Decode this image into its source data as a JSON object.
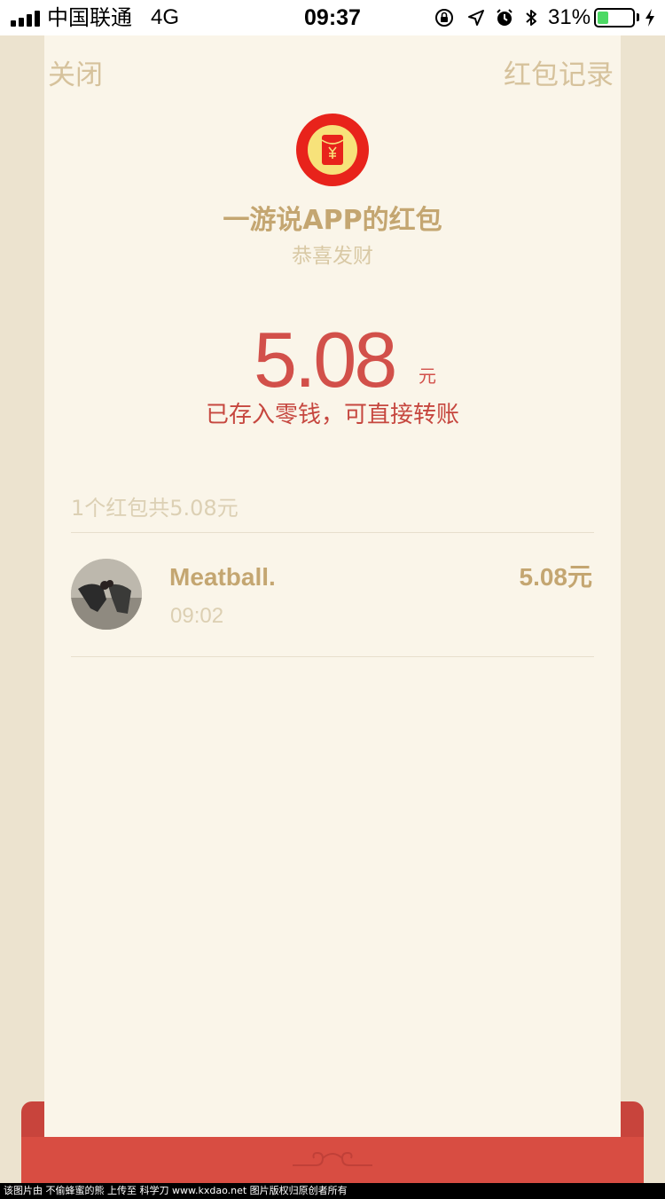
{
  "status_bar": {
    "carrier": "中国联通",
    "network": "4G",
    "time": "09:37",
    "battery_percent": "31%",
    "battery_level": 0.31,
    "icons": [
      "rotation-lock-icon",
      "location-arrow-icon",
      "alarm-icon",
      "bluetooth-icon",
      "charging-bolt-icon"
    ]
  },
  "nav": {
    "close_label": "关闭",
    "records_label": "红包记录"
  },
  "envelope": {
    "sender_title": "一游说APP的红包",
    "greeting": "恭喜发财",
    "amount": "5.08",
    "amount_unit": "元",
    "saved_note": "已存入零钱，可直接转账"
  },
  "summary": {
    "text": "1个红包共5.08元"
  },
  "receivers": [
    {
      "name": "Meatball.",
      "time": "09:02",
      "amount": "5.08元"
    }
  ],
  "footer": {
    "watermark": "该图片由 不偷蜂蜜的熊 上传至 科学刀 www.kxdao.net 图片版权归原创者所有"
  },
  "colors": {
    "accent_red": "#d2504a",
    "gold_text": "#c4a671",
    "card_bg": "#faf5e9",
    "page_bg": "#ece3cf",
    "bar_red": "#d84d42"
  }
}
